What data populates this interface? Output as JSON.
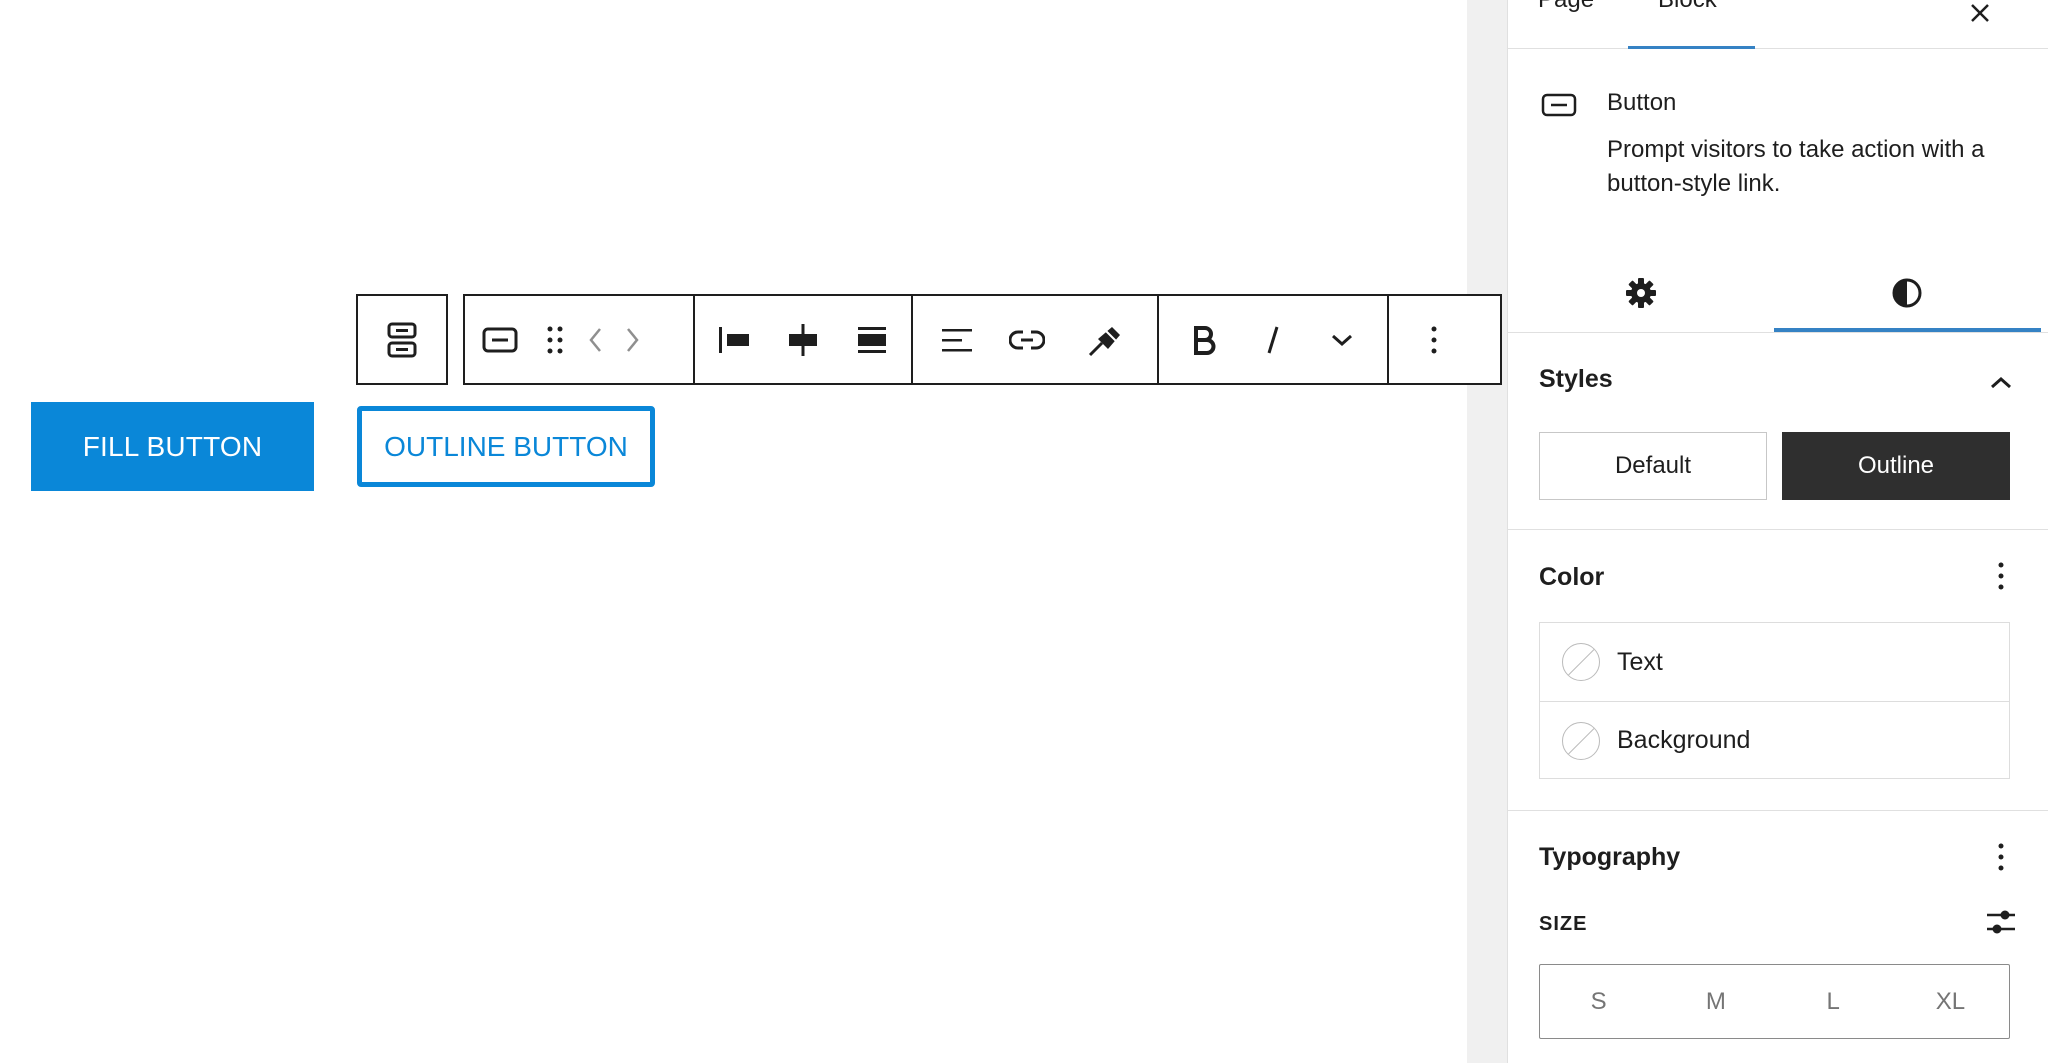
{
  "canvas": {
    "fill_button": {
      "label": "FILL BUTTON",
      "color": "#0a87d8"
    },
    "outline_button": {
      "label": "OUTLINE BUTTON",
      "color": "#0a87d8"
    }
  },
  "toolbar": {
    "icons": [
      "buttons-parent-icon",
      "button-block-icon",
      "drag-handle-icon",
      "move-left-icon",
      "move-right-icon",
      "justify-left-icon",
      "justify-center-icon",
      "justify-stretch-icon",
      "align-left-icon",
      "link-icon",
      "unlink-icon",
      "bold-icon",
      "italic-icon",
      "chevron-down-icon",
      "more-options-icon"
    ]
  },
  "sidebar": {
    "tabs": [
      {
        "label": "Page"
      },
      {
        "label": "Block"
      }
    ],
    "active_tab": "Block",
    "block": {
      "name": "Button",
      "description": "Prompt visitors to take action with a button-style link."
    },
    "sub_tabs": {
      "icons": [
        "gear-icon",
        "contrast-icon"
      ],
      "active": "contrast-icon"
    },
    "styles": {
      "title": "Styles",
      "options": [
        {
          "label": "Default"
        },
        {
          "label": "Outline"
        }
      ],
      "selected": "Outline"
    },
    "color": {
      "title": "Color",
      "items": [
        {
          "label": "Text"
        },
        {
          "label": "Background"
        }
      ]
    },
    "typography": {
      "title": "Typography",
      "size_label": "SIZE",
      "sizes": [
        "S",
        "M",
        "L",
        "XL"
      ]
    },
    "accent": "#3582c4"
  }
}
